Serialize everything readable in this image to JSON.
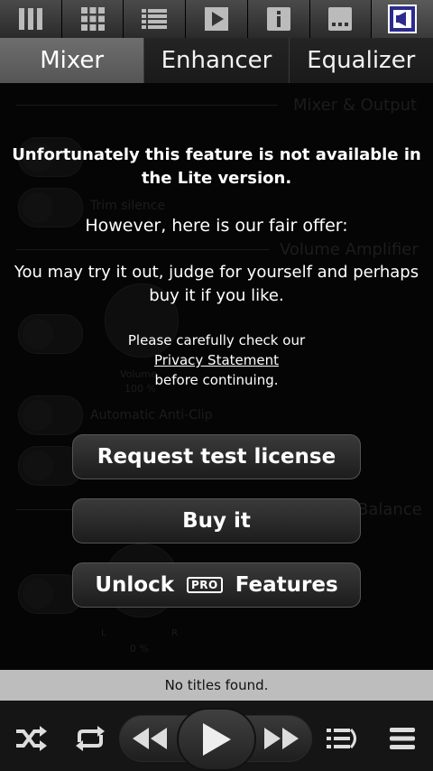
{
  "toolbar": {
    "items": [
      {
        "icon": "library-icon"
      },
      {
        "icon": "grid-icon"
      },
      {
        "icon": "list-icon"
      },
      {
        "icon": "play-square-icon"
      },
      {
        "icon": "info-icon"
      },
      {
        "icon": "more-icon"
      },
      {
        "icon": "audio-settings-icon"
      }
    ]
  },
  "tabs": {
    "mixer": "Mixer",
    "enhancer": "Enhancer",
    "equalizer": "Equalizer"
  },
  "background": {
    "section_mixer": "Mixer & Output",
    "trim": "Trim silence",
    "section_volume": "Volume Amplifier",
    "volume_label": "Volume",
    "volume_value": "100 %",
    "anticlip": "Automatic Anti-Clip",
    "balance": "Balance",
    "bal_l": "L",
    "bal_r": "R",
    "bal_value": "0 %"
  },
  "dialog": {
    "unavailable": "Unfortunately this feature is not available in the Lite version.",
    "offer": "However, here is our fair offer:",
    "try": "You may try it out, judge for yourself and perhaps buy it if you like.",
    "check": "Please carefully check our",
    "privacy": "Privacy Statement",
    "before": "before continuing.",
    "request_btn": "Request test license",
    "buy_btn": "Buy it",
    "unlock_word": "Unlock",
    "pro_badge": "PRO",
    "features_word": "Features"
  },
  "status": {
    "text": "No titles found."
  },
  "colors": {
    "accent": "#2b2b8f",
    "status_bg": "#bdbdbd"
  }
}
